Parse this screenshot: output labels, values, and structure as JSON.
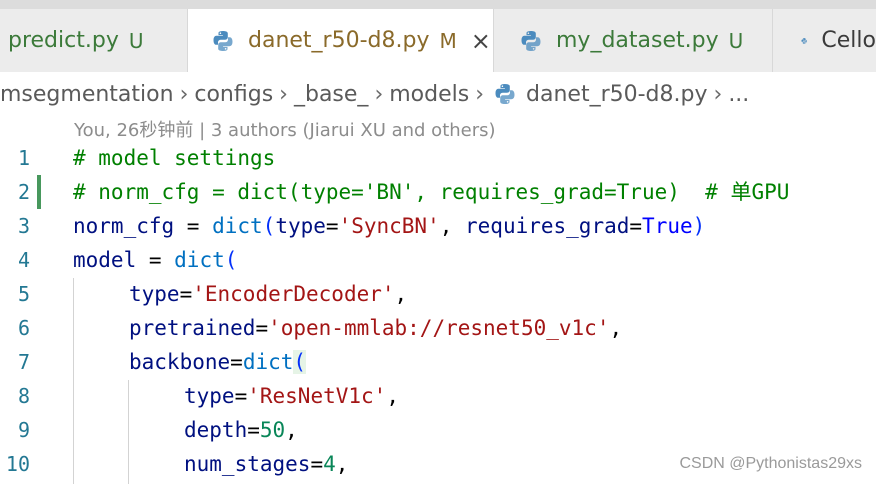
{
  "tabs": [
    {
      "label": "predict.py",
      "status": "U"
    },
    {
      "label": "danet_r50-d8.py",
      "status": "M",
      "close": "×"
    },
    {
      "label": "my_dataset.py",
      "status": "U"
    },
    {
      "label": "Cello"
    }
  ],
  "breadcrumb": {
    "items": [
      "msegmentation",
      "configs",
      "_base_",
      "models",
      "danet_r50-d8.py",
      "..."
    ],
    "separator": "›"
  },
  "blame": "You, 26秒钟前 | 3 authors (Jiarui XU and others)",
  "line_numbers": [
    "1",
    "2",
    "3",
    "4",
    "5",
    "6",
    "7",
    "8",
    "9",
    "10"
  ],
  "code": {
    "l1": "# model settings",
    "l2": "# norm_cfg = dict(type='BN', requires_grad=True)  # 单GPU",
    "l3_a": "norm_cfg",
    "l3_b": " = ",
    "l3_c": "dict",
    "l3_d": "(",
    "l3_e": "type",
    "l3_f": "=",
    "l3_g": "'SyncBN'",
    "l3_h": ", ",
    "l3_i": "requires_grad",
    "l3_j": "=",
    "l3_k": "True",
    "l3_l": ")",
    "l4_a": "model",
    "l4_b": " = ",
    "l4_c": "dict",
    "l4_d": "(",
    "l5_a": "type",
    "l5_b": "=",
    "l5_c": "'EncoderDecoder'",
    "l5_d": ",",
    "l6_a": "pretrained",
    "l6_b": "=",
    "l6_c": "'open-mmlab://resnet50_v1c'",
    "l6_d": ",",
    "l7_a": "backbone",
    "l7_b": "=",
    "l7_c": "dict",
    "l7_d": "(",
    "l8_a": "type",
    "l8_b": "=",
    "l8_c": "'ResNetV1c'",
    "l8_d": ",",
    "l9_a": "depth",
    "l9_b": "=",
    "l9_c": "50",
    "l9_d": ",",
    "l10_a": "num_stages",
    "l10_b": "=",
    "l10_c": "4",
    "l10_d": ","
  },
  "watermark": "CSDN @Pythonistas29xs"
}
